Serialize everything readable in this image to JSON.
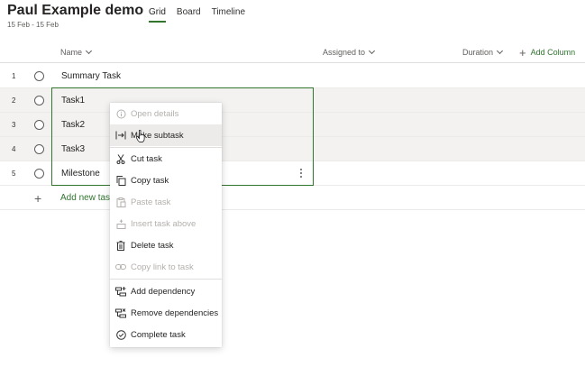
{
  "plan": {
    "title": "Paul Example demo",
    "date_range": "15 Feb - 15 Feb"
  },
  "tabs": [
    {
      "label": "Grid",
      "active": true
    },
    {
      "label": "Board"
    },
    {
      "label": "Timeline"
    }
  ],
  "columns": {
    "name": "Name",
    "assigned_to": "Assigned to",
    "duration": "Duration",
    "add_column": "Add Column"
  },
  "rows": [
    {
      "num": "1",
      "name": "Summary Task"
    },
    {
      "num": "2",
      "name": "Task1"
    },
    {
      "num": "3",
      "name": "Task2"
    },
    {
      "num": "4",
      "name": "Task3"
    },
    {
      "num": "5",
      "name": "Milestone"
    }
  ],
  "add_task": "Add new task",
  "context_menu": [
    {
      "label": "Open details",
      "icon": "info-icon",
      "disabled": true
    },
    {
      "label": "Make subtask",
      "icon": "indent-icon"
    },
    {
      "label": "Cut task",
      "icon": "scissors-icon"
    },
    {
      "label": "Copy task",
      "icon": "copy-icon"
    },
    {
      "label": "Paste task",
      "icon": "paste-icon",
      "disabled": true
    },
    {
      "label": "Insert task above",
      "icon": "insert-above-icon",
      "disabled": true
    },
    {
      "label": "Delete task",
      "icon": "trash-icon"
    },
    {
      "label": "Copy link to task",
      "icon": "link-icon",
      "disabled": true
    },
    {
      "label": "Add dependency",
      "icon": "add-dependency-icon"
    },
    {
      "label": "Remove dependencies",
      "icon": "remove-dependency-icon"
    },
    {
      "label": "Complete task",
      "icon": "check-circle-icon"
    }
  ],
  "colors": {
    "accent": "#31752f",
    "selected_row": "#f3f2f1",
    "disabled_text": "#b3b0ad"
  }
}
